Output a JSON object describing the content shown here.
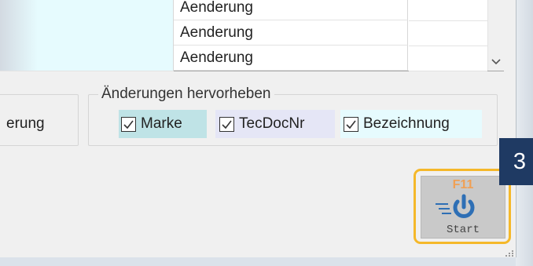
{
  "grid": {
    "rows": [
      {
        "text": "Aenderung"
      },
      {
        "text": "Aenderung"
      },
      {
        "text": "Aenderung"
      }
    ]
  },
  "left_group": {
    "partial_label": "erung"
  },
  "highlight_group": {
    "title": "Änderungen hervorheben",
    "checkboxes": [
      {
        "label": "Marke",
        "checked": true,
        "bg": "#bfe3e6"
      },
      {
        "label": "TecDocNr",
        "checked": true,
        "bg": "#e5e6f6"
      },
      {
        "label": "Bezeichnung",
        "checked": true,
        "bg": "#e6fbfe"
      }
    ]
  },
  "start_button": {
    "shortcut": "F11",
    "label": "Start",
    "border_color": "#f5b82a",
    "icon_color": "#2e6fb5"
  },
  "step_badge": {
    "number": "3",
    "color": "#1f3a63"
  }
}
